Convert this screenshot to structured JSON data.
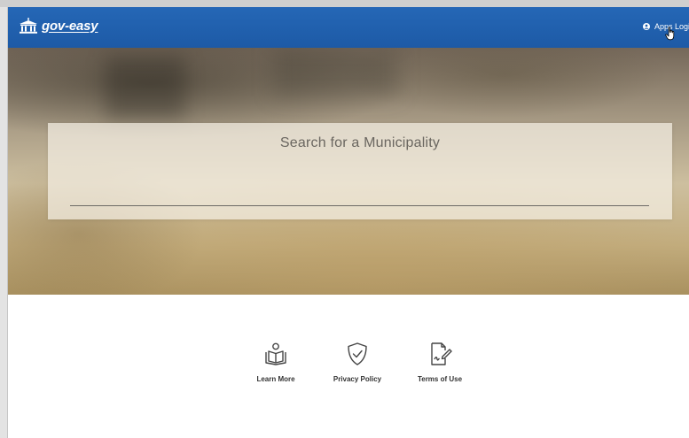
{
  "navbar": {
    "brand": "gov-easy",
    "login_label": "Apps Login",
    "brand_color": "#1f5fae"
  },
  "hero": {
    "title": "Search for a Municipality",
    "search_value": ""
  },
  "footer": {
    "links": [
      {
        "label": "Learn More",
        "icon": "book-reader-icon"
      },
      {
        "label": "Privacy Policy",
        "icon": "shield-check-icon"
      },
      {
        "label": "Terms of Use",
        "icon": "document-signature-icon"
      }
    ]
  }
}
